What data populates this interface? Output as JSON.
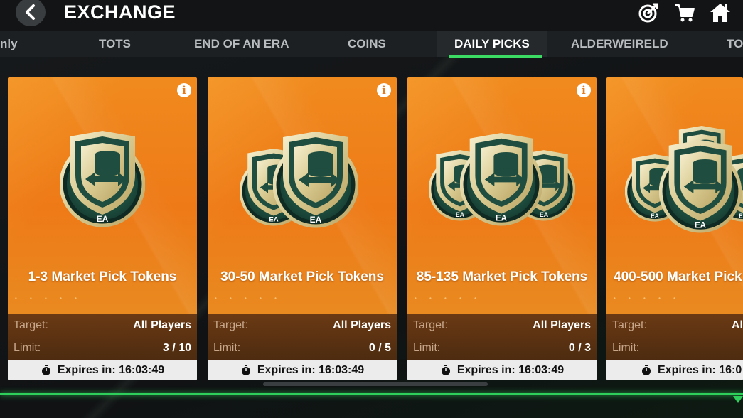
{
  "header": {
    "title": "EXCHANGE"
  },
  "tabs": [
    {
      "label": "nly"
    },
    {
      "label": "TOTS"
    },
    {
      "label": "END OF AN ERA"
    },
    {
      "label": "COINS"
    },
    {
      "label": "DAILY PICKS",
      "active": true
    },
    {
      "label": "ALDERWEIRELD"
    },
    {
      "label": "TO"
    }
  ],
  "cards": [
    {
      "name": "1-3 Market Pick Tokens",
      "target_label": "Target:",
      "target_value": "All Players",
      "limit_label": "Limit:",
      "limit_value": "3 / 10",
      "expires": "Expires in: 16:03:49",
      "token_count": 1
    },
    {
      "name": "30-50 Market Pick Tokens",
      "target_label": "Target:",
      "target_value": "All Players",
      "limit_label": "Limit:",
      "limit_value": "0 / 5",
      "expires": "Expires in: 16:03:49",
      "token_count": 2
    },
    {
      "name": "85-135 Market Pick Tokens",
      "target_label": "Target:",
      "target_value": "All Players",
      "limit_label": "Limit:",
      "limit_value": "0 / 3",
      "expires": "Expires in: 16:03:49",
      "token_count": 3
    },
    {
      "name": "400-500 Market Pick",
      "target_label": "Target:",
      "target_value": "Al",
      "limit_label": "Limit:",
      "limit_value": "",
      "expires": "Expires in: 16:0",
      "token_count": 4
    }
  ],
  "badge_text": "EA",
  "colors": {
    "accent": "#3cdc64",
    "card_orange": "#ee7a17",
    "token_green": "#1f4d3f",
    "token_gold": "#e8dcb0"
  },
  "icons": {
    "back": "chevron-left-icon",
    "objectives": "target-icon",
    "store": "cart-icon",
    "home": "home-icon",
    "info": "info-icon",
    "timer": "stopwatch-icon"
  }
}
